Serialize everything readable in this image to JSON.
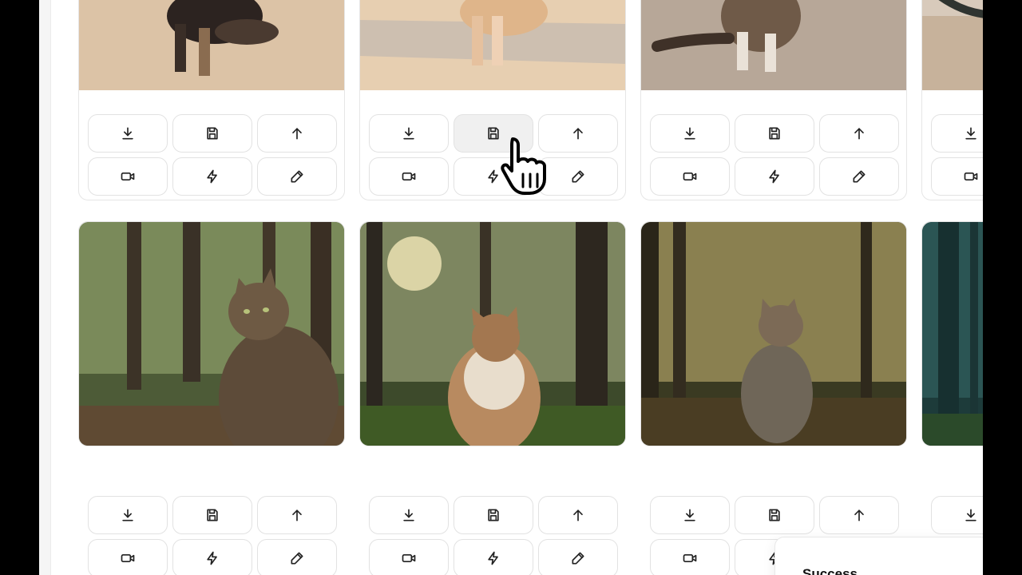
{
  "gallery": {
    "images": [
      {
        "alt": "calico-cat-on-beach"
      },
      {
        "alt": "orange-tabby-cat-on-beach"
      },
      {
        "alt": "tabby-cat-on-beach"
      },
      {
        "alt": "cat-on-beach-partial"
      },
      {
        "alt": "tabby-cat-in-forest"
      },
      {
        "alt": "fluffy-cat-in-forest"
      },
      {
        "alt": "tabby-cat-in-sunlit-forest"
      },
      {
        "alt": "forest-partial"
      }
    ],
    "actions": [
      "download-icon",
      "save-icon",
      "upscale-icon",
      "video-icon",
      "lightning-icon",
      "edit-icon"
    ]
  },
  "toast": {
    "title": "Success"
  },
  "colors": {
    "background": "#ffffff",
    "border": "#e2e2e2",
    "hover": "#f0f0f0"
  }
}
